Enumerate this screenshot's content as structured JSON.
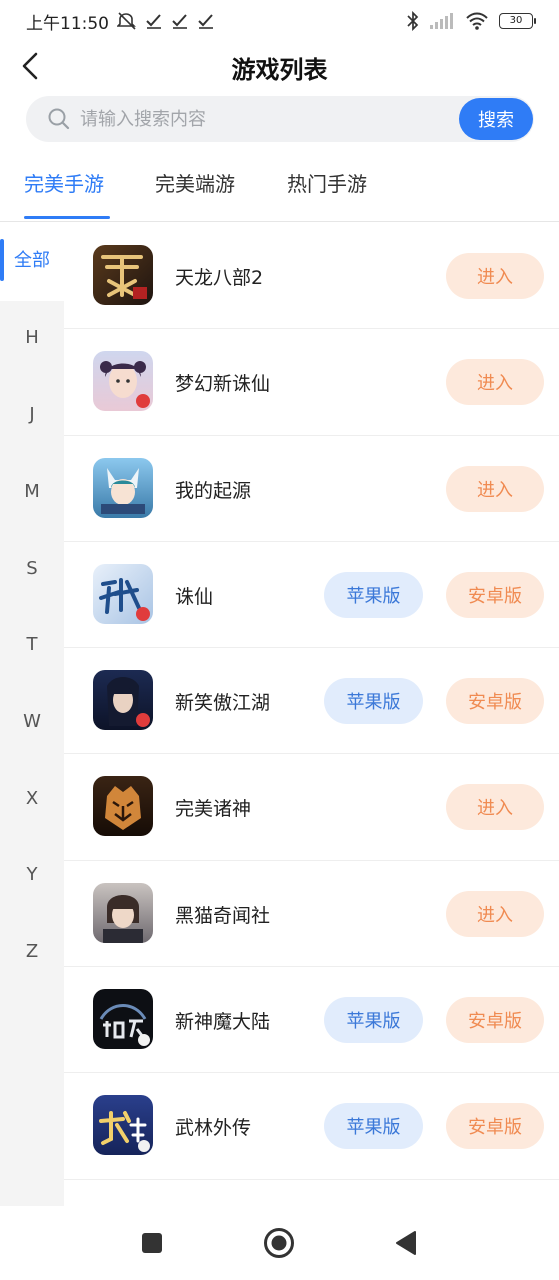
{
  "status_bar": {
    "time": "上午11:50",
    "battery": "30"
  },
  "header": {
    "title": "游戏列表"
  },
  "search": {
    "placeholder": "请输入搜索内容",
    "value": "",
    "button_label": "搜索"
  },
  "tabs": [
    {
      "label": "完美手游",
      "active": true
    },
    {
      "label": "完美端游",
      "active": false
    },
    {
      "label": "热门手游",
      "active": false
    }
  ],
  "index_sidebar": [
    "全部",
    "H",
    "J",
    "M",
    "S",
    "T",
    "W",
    "X",
    "Y",
    "Z"
  ],
  "games": [
    {
      "name": "天龙八部2",
      "buttons": [
        "进入"
      ]
    },
    {
      "name": "梦幻新诛仙",
      "buttons": [
        "进入"
      ]
    },
    {
      "name": "我的起源",
      "buttons": [
        "进入"
      ]
    },
    {
      "name": "诛仙",
      "buttons": [
        "苹果版",
        "安卓版"
      ]
    },
    {
      "name": "新笑傲江湖",
      "buttons": [
        "苹果版",
        "安卓版"
      ]
    },
    {
      "name": "完美诸神",
      "buttons": [
        "进入"
      ]
    },
    {
      "name": "黑猫奇闻社",
      "buttons": [
        "进入"
      ]
    },
    {
      "name": "新神魔大陆",
      "buttons": [
        "苹果版",
        "安卓版"
      ]
    },
    {
      "name": "武林外传",
      "buttons": [
        "苹果版",
        "安卓版"
      ]
    }
  ],
  "colors": {
    "accent": "#2f7cf6",
    "enter_bg": "#fde9dc",
    "enter_text": "#f08b52",
    "ios_bg": "#e1ecfc",
    "ios_text": "#3b78d8"
  },
  "icons": [
    "back-arrow-icon",
    "search-icon",
    "bluetooth-icon",
    "signal-icon",
    "wifi-icon",
    "battery-icon",
    "mute-icon",
    "check-icon",
    "recents-icon",
    "home-icon",
    "back-triangle-icon"
  ]
}
